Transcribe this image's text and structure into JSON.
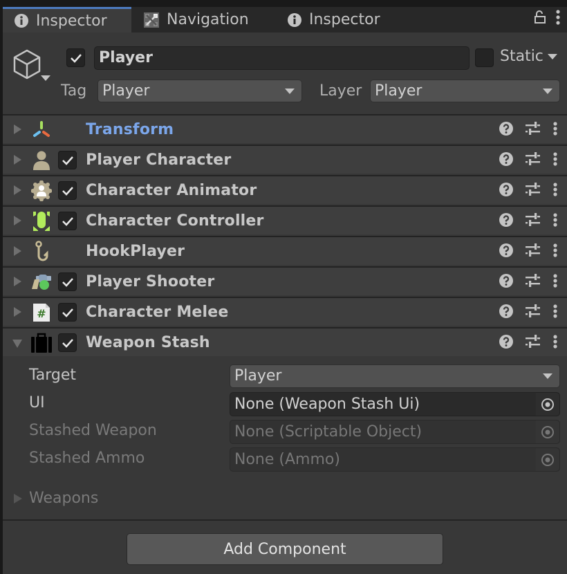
{
  "tabs": [
    {
      "label": "Inspector",
      "icon": "info-icon",
      "active": true
    },
    {
      "label": "Navigation",
      "icon": "navigation-icon",
      "active": false
    },
    {
      "label": "Inspector",
      "icon": "info-icon",
      "active": false
    }
  ],
  "tabbar_actions": [
    "lock-icon",
    "more-vert-icon"
  ],
  "accent_color": "#4d7bc0",
  "header": {
    "active": true,
    "name": "Player",
    "static_label": "Static",
    "static_checked": false,
    "tag_label": "Tag",
    "tag_value": "Player",
    "layer_label": "Layer",
    "layer_value": "Player"
  },
  "components": [
    {
      "name": "Transform",
      "icon": "transform-icon",
      "has_checkbox": false,
      "enabled": true,
      "expanded": false
    },
    {
      "name": "Player Character",
      "icon": "person-icon",
      "has_checkbox": true,
      "enabled": true,
      "expanded": false
    },
    {
      "name": "Character Animator",
      "icon": "gear-person-icon",
      "has_checkbox": true,
      "enabled": true,
      "expanded": false
    },
    {
      "name": "Character Controller",
      "icon": "capsule-icon",
      "has_checkbox": true,
      "enabled": true,
      "expanded": false
    },
    {
      "name": "HookPlayer",
      "icon": "hook-icon",
      "has_checkbox": false,
      "enabled": true,
      "expanded": false
    },
    {
      "name": "Player Shooter",
      "icon": "revolver-icon",
      "has_checkbox": true,
      "enabled": true,
      "expanded": false
    },
    {
      "name": "Character Melee",
      "icon": "script-icon",
      "has_checkbox": true,
      "enabled": true,
      "expanded": false
    },
    {
      "name": "Weapon Stash",
      "icon": "briefcase-icon",
      "has_checkbox": true,
      "enabled": true,
      "expanded": true
    }
  ],
  "weapon_stash": {
    "properties": [
      {
        "label": "Target",
        "value": "Player",
        "type": "dropdown",
        "disabled": false
      },
      {
        "label": "UI",
        "value": "None (Weapon Stash Ui)",
        "type": "object",
        "disabled": false
      },
      {
        "label": "Stashed Weapon",
        "value": "None (Scriptable Object)",
        "type": "object",
        "disabled": true
      },
      {
        "label": "Stashed Ammo",
        "value": "None (Ammo)",
        "type": "object",
        "disabled": true
      }
    ],
    "weapons_label": "Weapons"
  },
  "add_component_label": "Add Component"
}
